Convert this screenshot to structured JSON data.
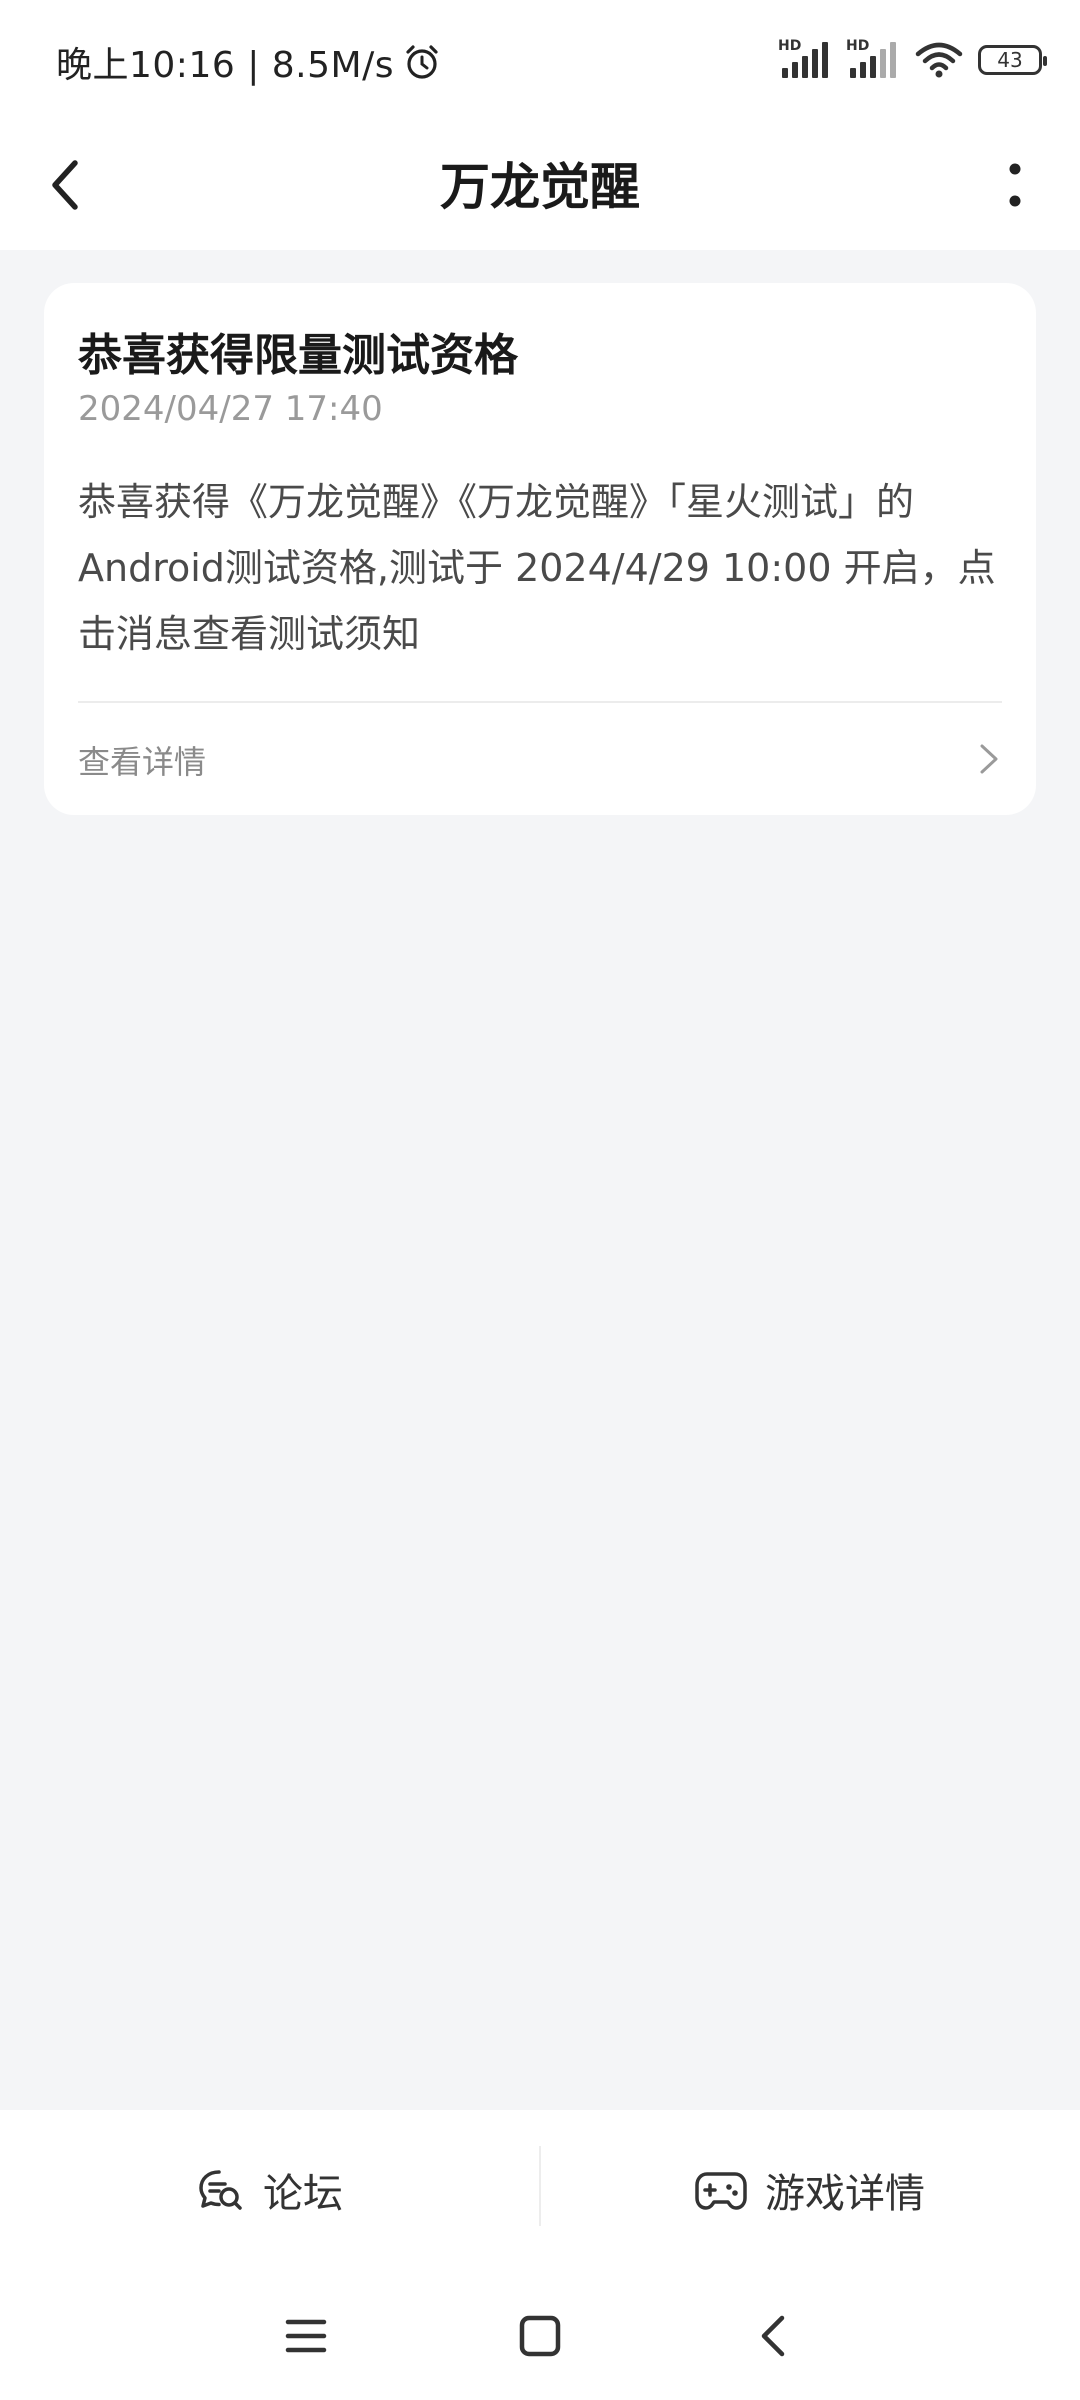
{
  "status_bar": {
    "time_speed": "晚上10:16 | 8.5M/s",
    "hd_label_1": "HD",
    "hd_label_2": "HD",
    "battery_level": "43"
  },
  "header": {
    "title": "万龙觉醒"
  },
  "message_card": {
    "title": "恭喜获得限量测试资格",
    "timestamp": "2024/04/27 17:40",
    "body_lines": [
      "恭喜获得《万龙觉醒》《万龙觉醒》「星火测试」的",
      "Android测试资格,测试于 2024/4/29 10:00 开启，点",
      "击消息查看测试须知"
    ],
    "detail_label": "查看详情"
  },
  "bottom_bar": {
    "forum_label": "论坛",
    "game_detail_label": "游戏详情"
  },
  "icons": {
    "back": "chevron-left-icon",
    "more": "more-vertical-icon",
    "detail_arrow": "chevron-right-icon",
    "forum": "forum-chat-icon",
    "game": "gamepad-icon",
    "sys_menu": "menu-icon",
    "sys_home": "home-square-icon",
    "sys_back": "back-triangle-icon"
  }
}
